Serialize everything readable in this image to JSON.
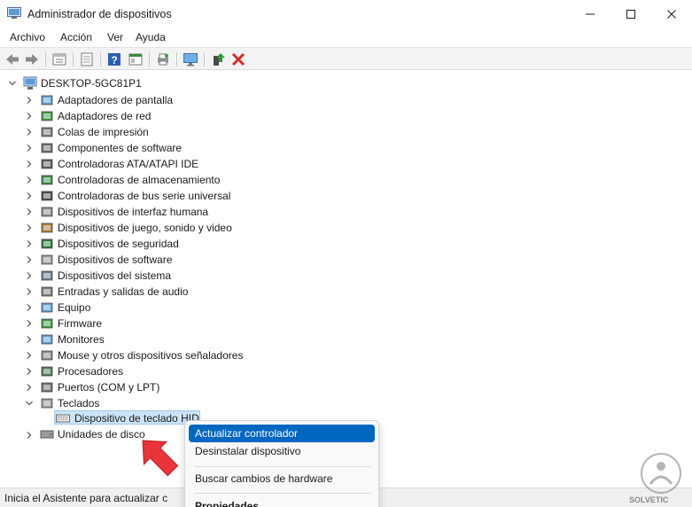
{
  "window": {
    "title": "Administrador de dispositivos",
    "controls": [
      "minimize-icon",
      "maximize-icon",
      "close-icon"
    ]
  },
  "menu": [
    "Archivo",
    "Acción",
    "Ver",
    "Ayuda"
  ],
  "toolbar": {
    "buttons": [
      "back-icon",
      "forward-icon",
      "properties-icon",
      "sheet-icon",
      "help-icon",
      "console-icon",
      "printer-icon",
      "monitor-icon",
      "update-driver-icon",
      "uninstall-icon"
    ]
  },
  "tree": {
    "root": "DESKTOP-5GC81P1",
    "categories": [
      "Adaptadores de pantalla",
      "Adaptadores de red",
      "Colas de impresión",
      "Componentes de software",
      "Controladoras ATA/ATAPI IDE",
      "Controladoras de almacenamiento",
      "Controladoras de bus serie universal",
      "Dispositivos de interfaz humana",
      "Dispositivos de juego, sonido y video",
      "Dispositivos de seguridad",
      "Dispositivos de software",
      "Dispositivos del sistema",
      "Entradas y salidas de audio",
      "Equipo",
      "Firmware",
      "Monitores",
      "Mouse y otros dispositivos señaladores",
      "Procesadores",
      "Puertos (COM y LPT)",
      "Teclados"
    ],
    "expanded_category": "Teclados",
    "child": "Dispositivo de teclado HID",
    "after": "Unidades de disco"
  },
  "context_menu": {
    "items": [
      "Actualizar controlador",
      "Desinstalar dispositivo",
      "Buscar cambios de hardware",
      "Propiedades"
    ],
    "highlighted": "Actualizar controlador"
  },
  "status": "Inicia el Asistente para actualizar c",
  "watermark": "SOLVETIC",
  "colors": {
    "accent": "#0067c0",
    "selection": "#cce4f7",
    "arrow": "#e8343a"
  }
}
